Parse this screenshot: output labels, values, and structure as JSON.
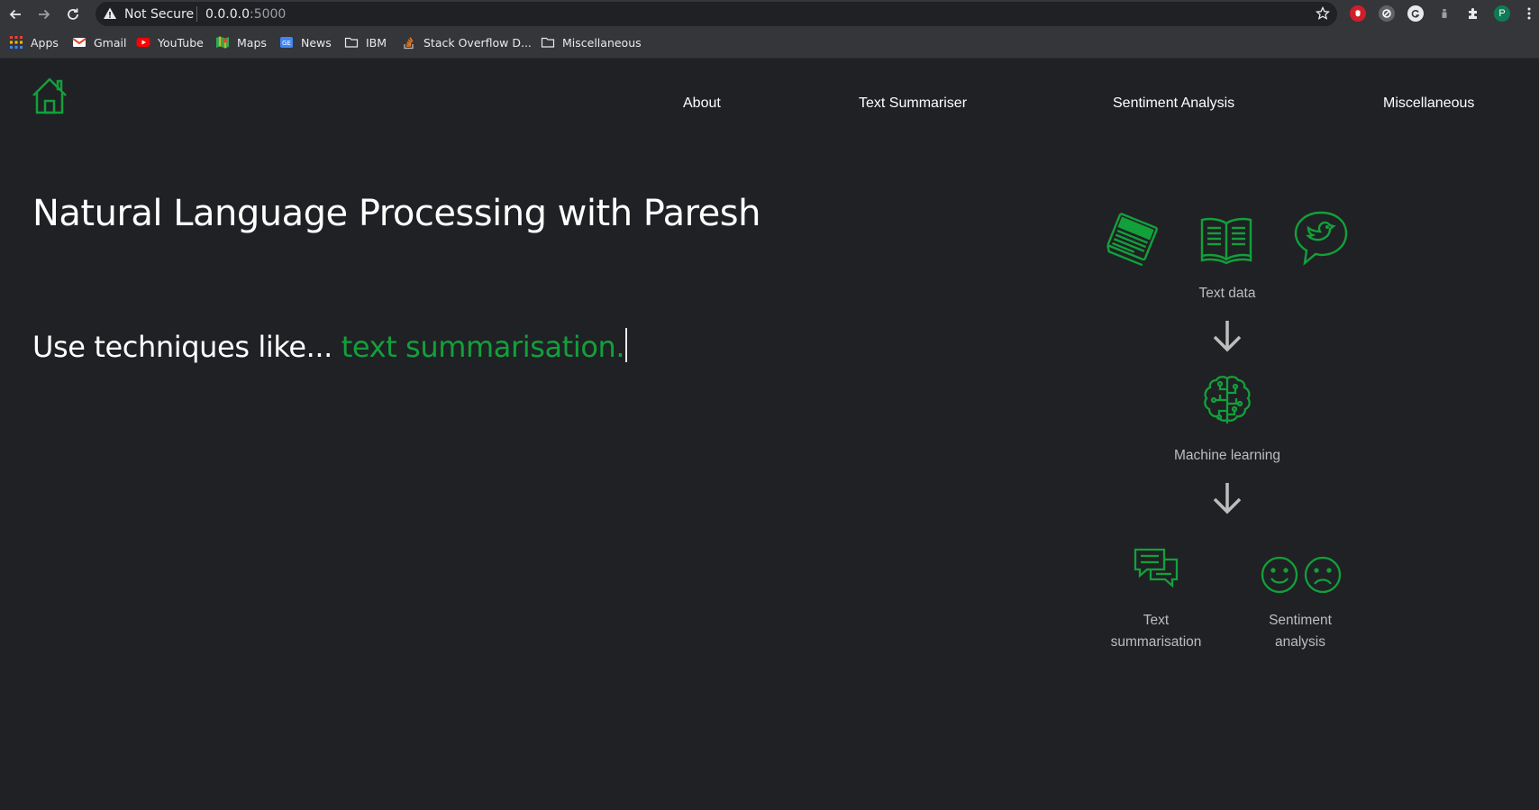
{
  "browser": {
    "security_label": "Not Secure",
    "url_host": "0.0.0.0",
    "url_port": ":5000",
    "profile_initial": "P",
    "bookmarks": [
      {
        "label": "Apps",
        "icon": "apps-grid-icon"
      },
      {
        "label": "Gmail",
        "icon": "gmail-icon"
      },
      {
        "label": "YouTube",
        "icon": "youtube-icon"
      },
      {
        "label": "Maps",
        "icon": "maps-icon"
      },
      {
        "label": "News",
        "icon": "news-icon"
      },
      {
        "label": "IBM",
        "icon": "folder-icon"
      },
      {
        "label": "Stack Overflow D...",
        "icon": "stackoverflow-icon"
      },
      {
        "label": "Miscellaneous",
        "icon": "folder-icon"
      }
    ]
  },
  "nav": {
    "links": [
      "About",
      "Text Summariser",
      "Sentiment Analysis",
      "Miscellaneous"
    ]
  },
  "hero": {
    "title": "Natural Language Processing with Paresh",
    "tagline_prefix": "Use techniques like... ",
    "tagline_typed": "text summarisation."
  },
  "diagram": {
    "input_label": "Text data",
    "model_label": "Machine learning",
    "output_left_line1": "Text",
    "output_left_line2": "summarisation",
    "output_right_line1": "Sentiment",
    "output_right_line2": "analysis"
  },
  "colors": {
    "accent": "#12a03b",
    "background": "#202124",
    "label_gray": "#bdbdbd"
  }
}
